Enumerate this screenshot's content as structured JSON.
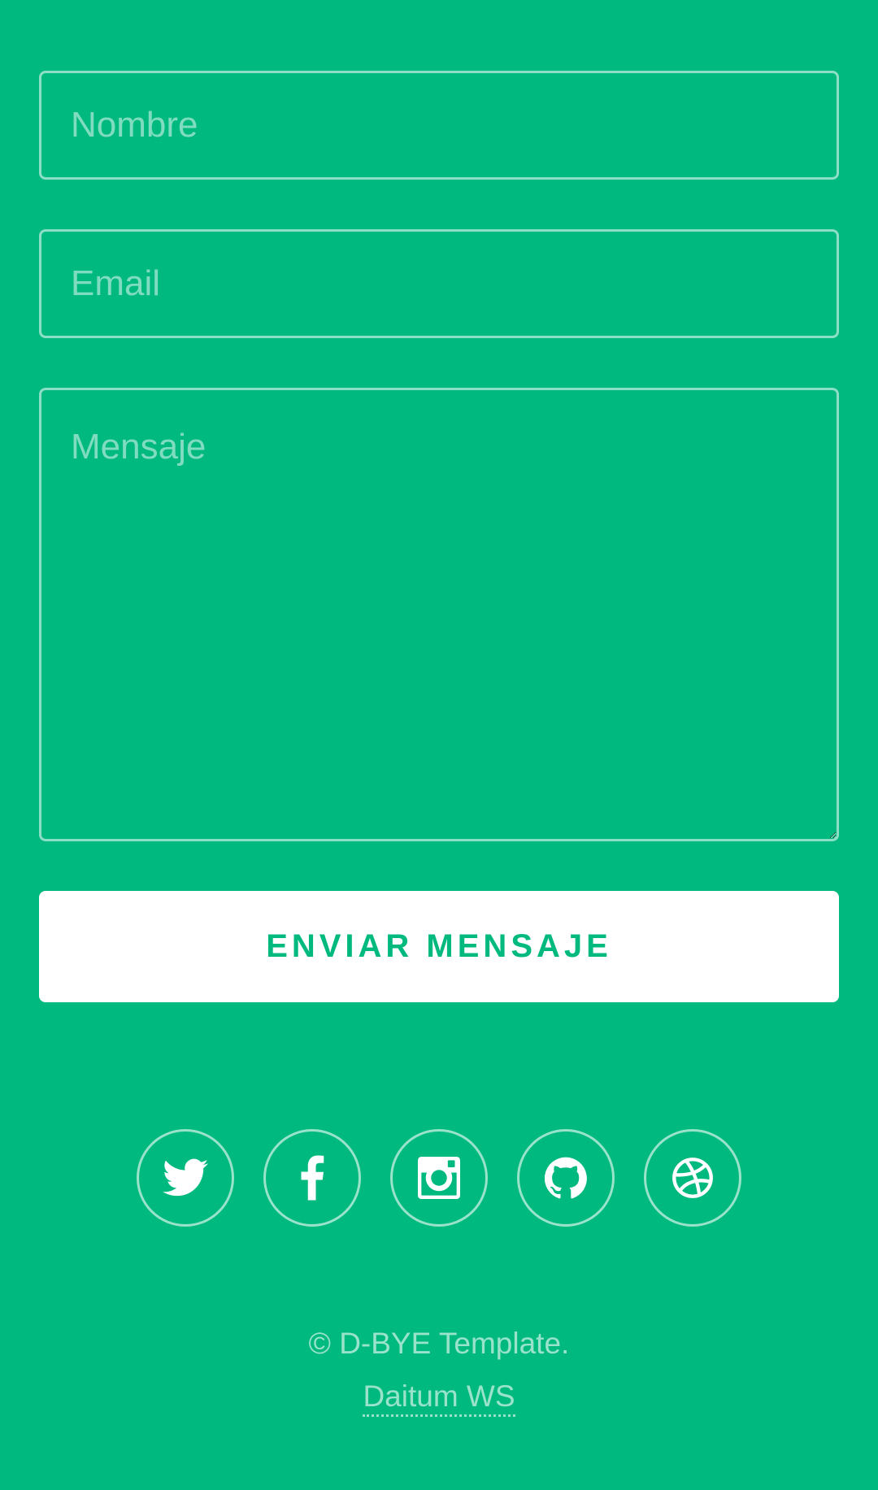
{
  "form": {
    "name_placeholder": "Nombre",
    "email_placeholder": "Email",
    "message_placeholder": "Mensaje",
    "submit_label": "ENVIAR MENSAJE"
  },
  "social": [
    {
      "icon": "twitter-icon"
    },
    {
      "icon": "facebook-icon"
    },
    {
      "icon": "instagram-icon"
    },
    {
      "icon": "github-icon"
    },
    {
      "icon": "dribbble-icon"
    }
  ],
  "footer": {
    "copyright": "© D-BYE Template.",
    "credit_link": "Daitum WS"
  },
  "colors": {
    "background": "#00b97e",
    "button_bg": "#ffffff",
    "button_text": "#00b97e"
  }
}
